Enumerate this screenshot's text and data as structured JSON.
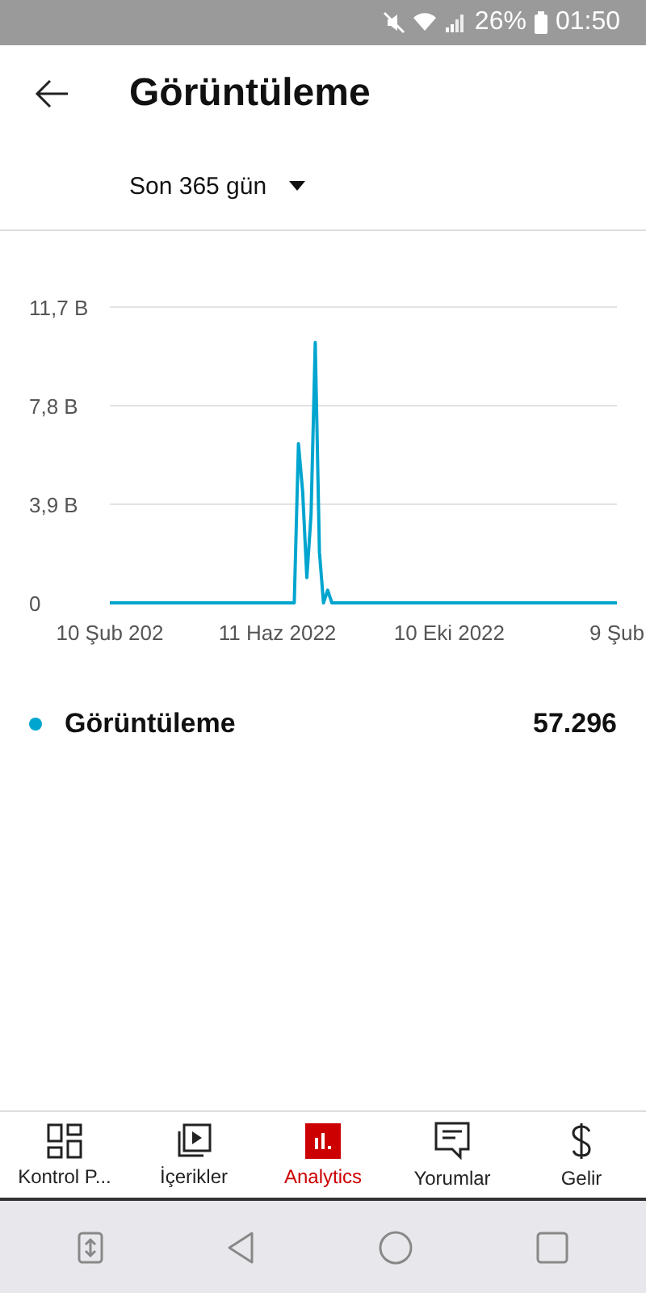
{
  "status_bar": {
    "battery": "26%",
    "time": "01:50"
  },
  "header": {
    "title": "Görüntüleme"
  },
  "period": {
    "label": "Son 365 gün"
  },
  "chart": {
    "chart_data": {
      "type": "line",
      "categories": [
        "10 Şub 202",
        null,
        null,
        null,
        null,
        null,
        null,
        null,
        null,
        null,
        null,
        null,
        null,
        null,
        null,
        null,
        null,
        null,
        null,
        null,
        null,
        null,
        null,
        null,
        null,
        null,
        null,
        null,
        null,
        null,
        null,
        null,
        null,
        null,
        null,
        null,
        null,
        null,
        null,
        null,
        "11 Haz 2022",
        null,
        null,
        null,
        null,
        null,
        null,
        null,
        null,
        null,
        null,
        null,
        null,
        null,
        null,
        null,
        null,
        null,
        null,
        null,
        null,
        null,
        null,
        null,
        null,
        null,
        null,
        null,
        null,
        null,
        null,
        null,
        null,
        null,
        null,
        null,
        null,
        null,
        null,
        null,
        null,
        "10 Eki 2022",
        null,
        null,
        null,
        null,
        null,
        null,
        null,
        null,
        null,
        null,
        null,
        null,
        null,
        null,
        null,
        null,
        null,
        null,
        null,
        null,
        null,
        null,
        null,
        null,
        null,
        null,
        null,
        null,
        null,
        null,
        null,
        null,
        null,
        null,
        null,
        null,
        null,
        null,
        null,
        "9 Şub"
      ],
      "series": [
        {
          "name": "Görüntüleme",
          "color": "#00a5cf",
          "values": [
            0,
            0,
            0,
            0,
            0,
            0,
            0,
            0,
            0,
            0,
            0,
            0,
            0,
            0,
            0,
            0,
            0,
            0,
            0,
            0,
            0,
            0,
            0,
            0,
            0,
            0,
            0,
            0,
            0,
            0,
            0,
            0,
            0,
            0,
            0,
            0,
            0,
            0,
            0,
            0,
            0,
            0,
            0,
            0,
            0,
            6.3,
            4.4,
            1.0,
            3.5,
            10.3,
            2.0,
            0,
            0.5,
            0,
            0,
            0,
            0,
            0,
            0,
            0,
            0,
            0,
            0,
            0,
            0,
            0,
            0,
            0,
            0,
            0,
            0,
            0,
            0,
            0,
            0,
            0,
            0,
            0,
            0,
            0,
            0,
            0,
            0,
            0,
            0,
            0,
            0,
            0,
            0,
            0,
            0,
            0,
            0,
            0,
            0,
            0,
            0,
            0,
            0,
            0,
            0,
            0,
            0,
            0,
            0,
            0,
            0,
            0,
            0,
            0,
            0,
            0,
            0,
            0,
            0,
            0,
            0,
            0,
            0,
            0,
            0,
            0
          ]
        }
      ],
      "ylim": [
        0,
        11.7
      ],
      "yticks": [
        {
          "value": 0,
          "label": "0"
        },
        {
          "value": 3.9,
          "label": "3,9 B"
        },
        {
          "value": 7.8,
          "label": "7,8 B"
        },
        {
          "value": 11.7,
          "label": "11,7 B"
        }
      ]
    }
  },
  "legend": {
    "value": "57.296"
  },
  "tabs": [
    {
      "label": "Kontrol P...",
      "selected": false
    },
    {
      "label": "İçerikler",
      "selected": false
    },
    {
      "label": "Analytics",
      "selected": true
    },
    {
      "label": "Yorumlar",
      "selected": false
    },
    {
      "label": "Gelir",
      "selected": false
    }
  ]
}
